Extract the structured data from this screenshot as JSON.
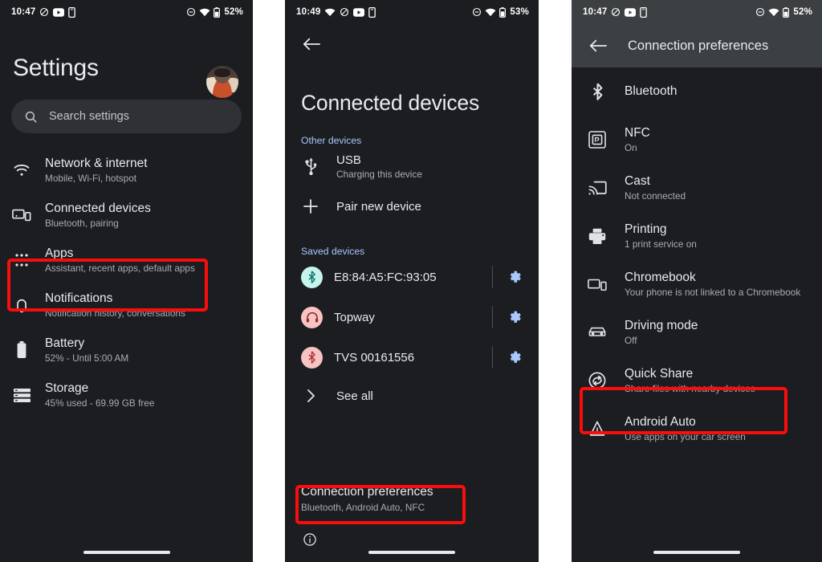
{
  "panels": {
    "settings": {
      "statusbar": {
        "time": "10:47",
        "battery": "52%",
        "icons": [
          "dnd-slash-icon",
          "youtube-icon",
          "device-icon",
          "minus-circle-icon",
          "wifi-icon",
          "battery-icon"
        ]
      },
      "avatar_name": "user-avatar",
      "title": "Settings",
      "search": {
        "placeholder": "Search settings",
        "icon": "search-icon"
      },
      "items": [
        {
          "icon": "wifi-icon",
          "title": "Network & internet",
          "subtitle": "Mobile, Wi-Fi, hotspot"
        },
        {
          "icon": "devices-icon",
          "title": "Connected devices",
          "subtitle": "Bluetooth, pairing",
          "highlighted": true
        },
        {
          "icon": "apps-grid-icon",
          "title": "Apps",
          "subtitle": "Assistant, recent apps, default apps"
        },
        {
          "icon": "bell-icon",
          "title": "Notifications",
          "subtitle": "Notification history, conversations"
        },
        {
          "icon": "battery-icon",
          "title": "Battery",
          "subtitle": "52% - Until 5:00 AM"
        },
        {
          "icon": "storage-icon",
          "title": "Storage",
          "subtitle": "45% used - 69.99 GB free"
        }
      ]
    },
    "connected_devices": {
      "statusbar": {
        "time": "10:49",
        "battery": "53%"
      },
      "back_icon": "back-arrow-icon",
      "title": "Connected devices",
      "sections": [
        {
          "header": "Other devices",
          "items": [
            {
              "icon": "usb-icon",
              "title": "USB",
              "subtitle": "Charging this device"
            },
            {
              "icon": "plus-icon",
              "title": "Pair new device",
              "subtitle": ""
            }
          ]
        }
      ],
      "saved_header": "Saved devices",
      "saved_devices": [
        {
          "chip": "bluetooth-connected-icon",
          "chip_style": "chip-bt-connected",
          "name": "E8:84:A5:FC:93:05",
          "gear": "gear-icon"
        },
        {
          "chip": "headset-icon",
          "chip_style": "chip-headset",
          "name": "Topway",
          "gear": "gear-icon"
        },
        {
          "chip": "bluetooth-icon",
          "chip_style": "chip-bt-saved",
          "name": "TVS 00161556",
          "gear": "gear-icon"
        }
      ],
      "see_all": {
        "icon": "chevron-right-icon",
        "label": "See all"
      },
      "connection_preferences": {
        "title": "Connection preferences",
        "subtitle": "Bluetooth, Android Auto, NFC",
        "highlighted": true
      },
      "info_icon": "info-circle-icon"
    },
    "connection_preferences": {
      "statusbar": {
        "time": "10:47",
        "battery": "52%"
      },
      "appbar": {
        "back_icon": "back-arrow-icon",
        "title": "Connection preferences"
      },
      "items": [
        {
          "icon": "bluetooth-icon",
          "title": "Bluetooth",
          "subtitle": ""
        },
        {
          "icon": "nfc-icon",
          "title": "NFC",
          "subtitle": "On"
        },
        {
          "icon": "cast-icon",
          "title": "Cast",
          "subtitle": "Not connected"
        },
        {
          "icon": "printer-icon",
          "title": "Printing",
          "subtitle": "1 print service on"
        },
        {
          "icon": "chromebook-icon",
          "title": "Chromebook",
          "subtitle": "Your phone is not linked to a Chromebook"
        },
        {
          "icon": "car-icon",
          "title": "Driving mode",
          "subtitle": "Off"
        },
        {
          "icon": "quick-share-icon",
          "title": "Quick Share",
          "subtitle": "Share files with nearby devices",
          "highlighted": true
        },
        {
          "icon": "android-auto-icon",
          "title": "Android Auto",
          "subtitle": "Use apps on your car screen"
        }
      ]
    }
  },
  "colors": {
    "panel_background": "#1b1d21",
    "appbar_background": "#3c4043",
    "accent_blue": "#a8c7fa",
    "highlight_red": "#f90d0d",
    "primary_text": "#e8eaed",
    "secondary_text": "#a9acb1"
  }
}
